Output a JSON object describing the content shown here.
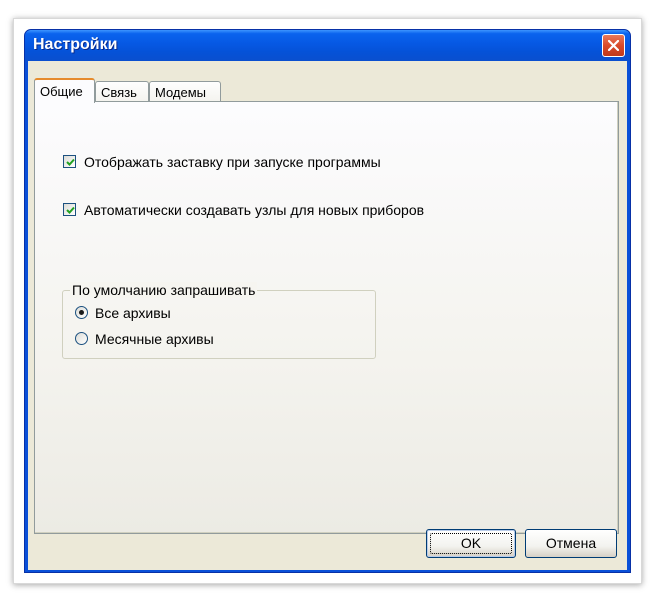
{
  "window": {
    "title": "Настройки"
  },
  "tabs": [
    {
      "label": "Общие",
      "active": true
    },
    {
      "label": "Связь",
      "active": false
    },
    {
      "label": "Модемы",
      "active": false
    }
  ],
  "general": {
    "checkboxes": [
      {
        "label": "Отображать заставку при запуске программы",
        "checked": true
      },
      {
        "label": "Автоматически создавать узлы для новых приборов",
        "checked": true
      }
    ],
    "archive_group": {
      "legend": "По умолчанию запрашивать",
      "options": [
        {
          "label": "Все архивы",
          "selected": true
        },
        {
          "label": "Месячные архивы",
          "selected": false
        }
      ]
    }
  },
  "buttons": {
    "ok": "OK",
    "cancel": "Отмена"
  },
  "icons": {
    "close": "close-icon",
    "check": "checkmark-icon"
  },
  "colors": {
    "titlebar": "#0a5ae0",
    "client": "#ece9d8",
    "close_button": "#d94a2a",
    "active_tab_accent": "#e68b2c"
  }
}
